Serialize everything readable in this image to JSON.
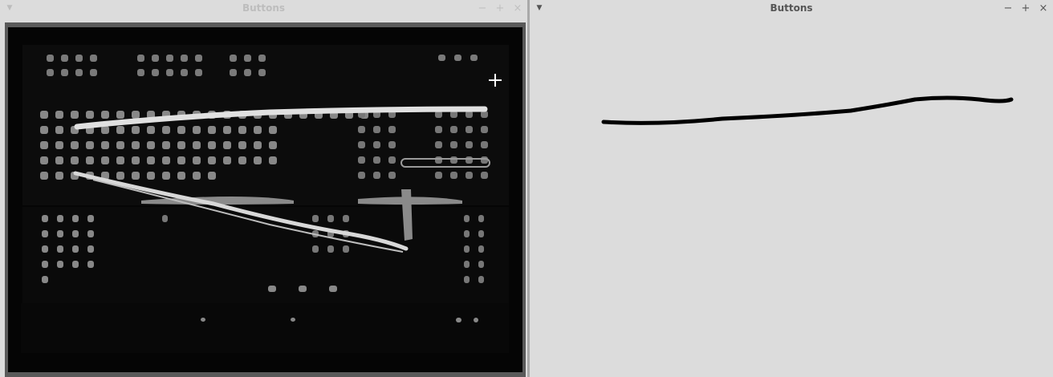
{
  "windows": {
    "left": {
      "title": "Buttons"
    },
    "right": {
      "title": "Buttons"
    }
  },
  "icons": {
    "menu": "chevron-down-icon",
    "minimize": "minimize-icon",
    "maximize": "maximize-icon",
    "close": "close-icon",
    "crosshair": "crosshair-icon"
  }
}
